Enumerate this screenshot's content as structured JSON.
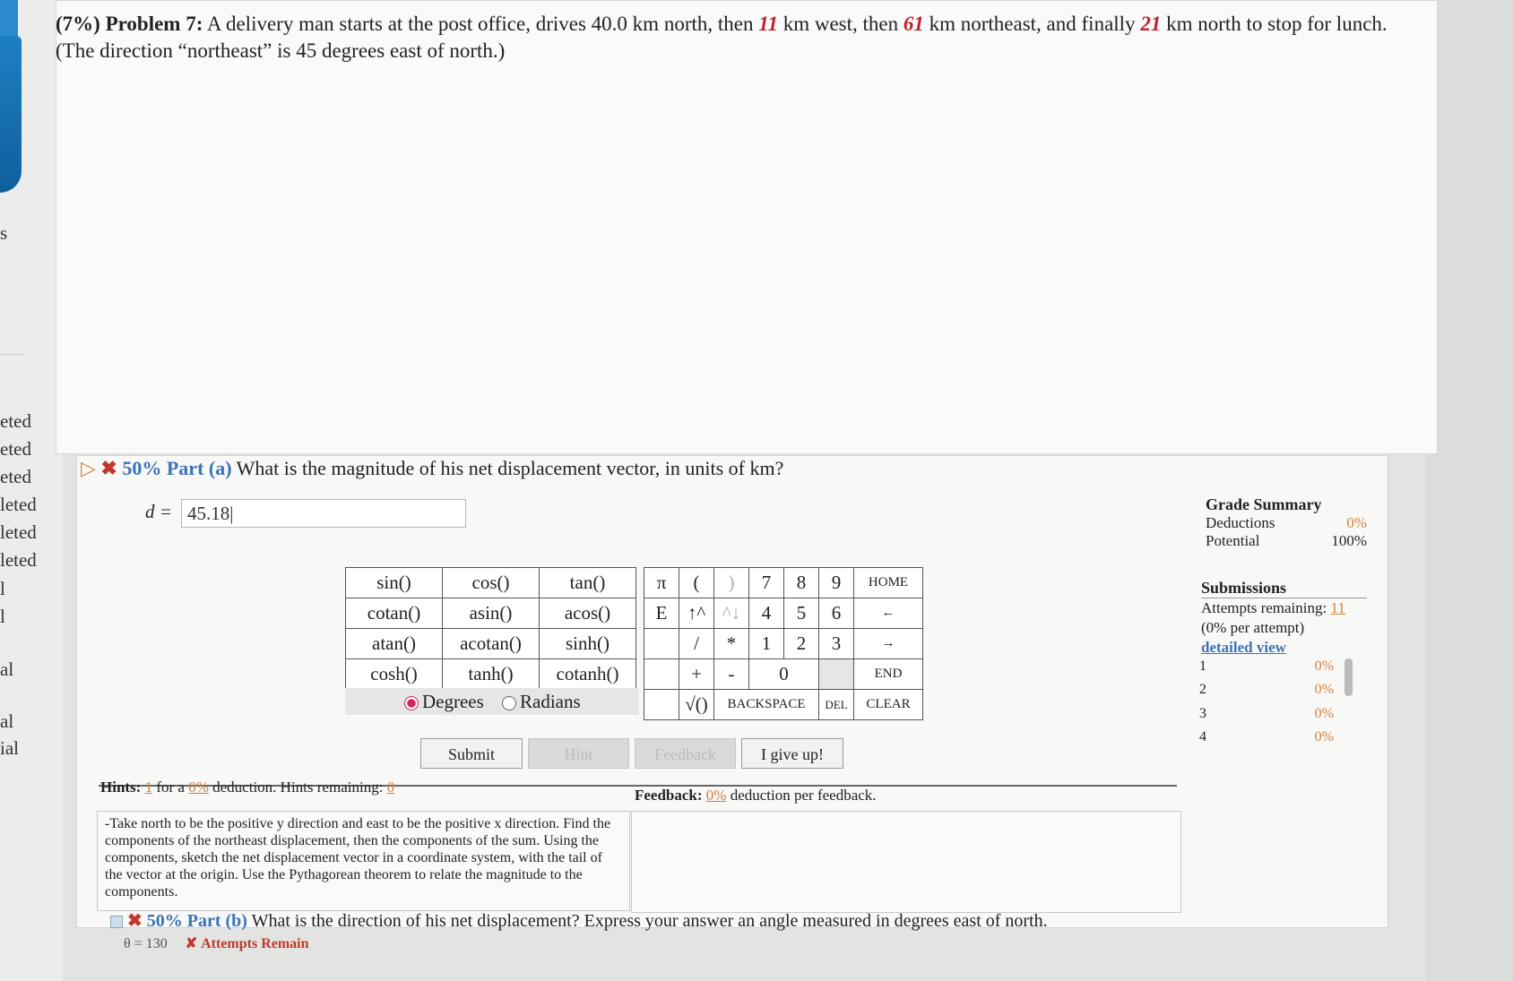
{
  "sidebar": {
    "fragments": [
      "s",
      "eted",
      "eted",
      "eted",
      "leted",
      "leted",
      "leted",
      "l",
      "l",
      "al",
      "al",
      "ial"
    ]
  },
  "problem": {
    "percent": "(7%)",
    "number": "Problem 7:",
    "text_1": "A delivery man starts at the post office, drives 40.0 km north, then",
    "val_west": "11",
    "text_2": "km west, then",
    "val_ne": "61",
    "text_3": "km northeast, and finally",
    "val_north": "21",
    "text_4": "km north to stop for lunch. (The direction “northeast” is 45 degrees east of north.)"
  },
  "part_a": {
    "percent": "50%",
    "label": "Part (a)",
    "question": "What is the magnitude of his net displacement vector, in units of km?",
    "var": "d =",
    "answer": "45.18|"
  },
  "function_keys": [
    [
      "sin()",
      "cos()",
      "tan()"
    ],
    [
      "cotan()",
      "asin()",
      "acos()"
    ],
    [
      "atan()",
      "acotan()",
      "sinh()"
    ],
    [
      "cosh()",
      "tanh()",
      "cotanh()"
    ]
  ],
  "angle_mode": {
    "degrees": "Degrees",
    "radians": "Radians",
    "selected": "Degrees"
  },
  "num_keys": {
    "pi": "π",
    "lparen": "(",
    "rparen": ")",
    "k7": "7",
    "k8": "8",
    "k9": "9",
    "home": "HOME",
    "e": "E",
    "up": "↑^",
    "down": "^↓",
    "k4": "4",
    "k5": "5",
    "k6": "6",
    "left": "←",
    "div": "/",
    "mul": "*",
    "k1": "1",
    "k2": "2",
    "k3": "3",
    "right": "→",
    "plus": "+",
    "minus": "-",
    "k0": "0",
    "end": "END",
    "sqrt": "√()",
    "backspace": "BACKSPACE",
    "del": "DEL",
    "clear": "CLEAR"
  },
  "buttons": {
    "submit": "Submit",
    "hint": "Hint",
    "feedback": "Feedback",
    "give_up": "I give up!"
  },
  "grade_summary": {
    "title": "Grade Summary",
    "deductions_label": "Deductions",
    "deductions_value": "0%",
    "potential_label": "Potential",
    "potential_value": "100%"
  },
  "submissions": {
    "title": "Submissions",
    "attempts_label": "Attempts remaining:",
    "attempts_value": "11",
    "per_attempt": "(0% per attempt)",
    "detailed_view": "detailed view",
    "attempts": [
      {
        "n": "1",
        "pct": "0%"
      },
      {
        "n": "2",
        "pct": "0%"
      },
      {
        "n": "3",
        "pct": "0%"
      },
      {
        "n": "4",
        "pct": "0%"
      }
    ]
  },
  "hints": {
    "label": "Hints:",
    "count": "1",
    "for_a": "for a",
    "deduction": "0%",
    "suffix": "deduction. Hints remaining:",
    "remaining": "0",
    "body": "-Take north to be the positive y direction and east to be the positive x direction. Find the components of the northeast displacement, then the components of the sum. Using the components, sketch the net displacement vector in a coordinate system, with the tail of the vector at the origin. Use the Pythagorean theorem to relate the magnitude to the components."
  },
  "feedback": {
    "label": "Feedback:",
    "value": "0%",
    "suffix": "deduction per feedback."
  },
  "part_b": {
    "percent": "50%",
    "label": "Part (b)",
    "question": "What is the direction of his net displacement? Express your answer an angle measured in degrees east of north.",
    "answer": "θ = 130",
    "status": "✘ Attempts Remain"
  }
}
